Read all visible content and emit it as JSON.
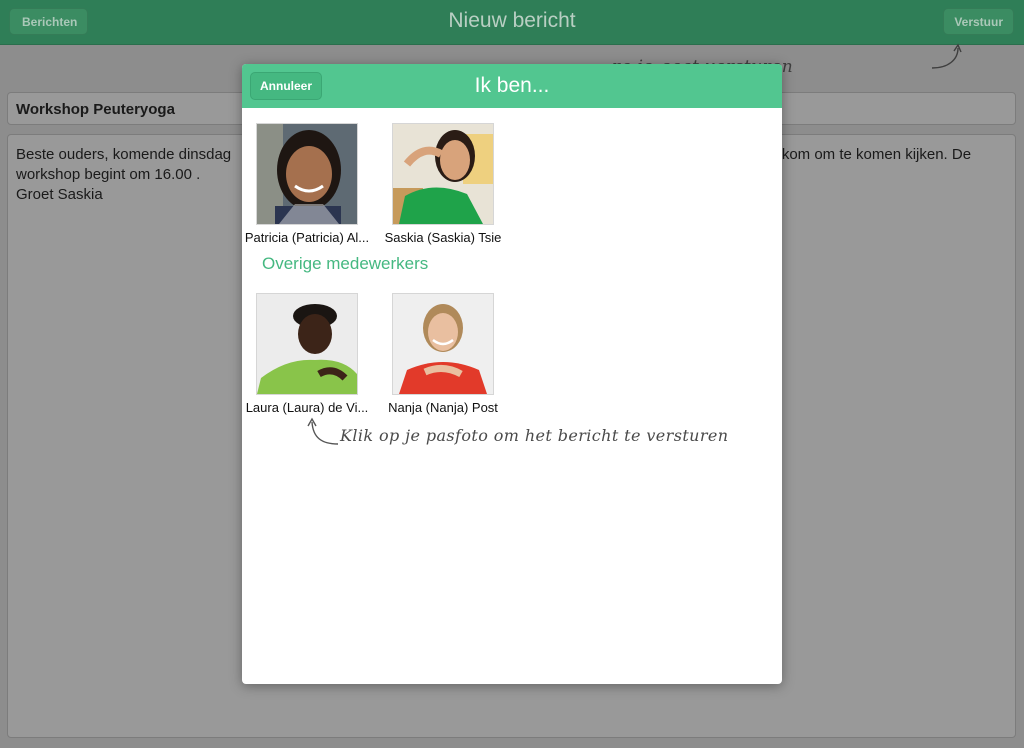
{
  "navbar": {
    "back_label": "Berichten",
    "title": "Nieuw bericht",
    "send_label": "Verstuur"
  },
  "message": {
    "subject": "Workshop Peuteryoga",
    "body_left": "Beste ouders, komende dinsdag",
    "body_right": "elkom om te komen kijken. De",
    "body_rest": "workshop begint om 16.00 .\nGroet Saskia"
  },
  "hint_top": "ra je gaat versturen",
  "modal": {
    "cancel_label": "Annuleer",
    "title": "Ik ben...",
    "people": [
      {
        "name": "Patricia (Patricia) Al..."
      },
      {
        "name": "Saskia (Saskia) Tsie"
      }
    ],
    "other_section_title": "Overige medewerkers",
    "other_people": [
      {
        "name": "Laura (Laura) de Vi..."
      },
      {
        "name": "Nanja (Nanja) Post"
      }
    ],
    "hint": "Klik op je pasfoto om het bericht te versturen"
  },
  "colors": {
    "accent": "#52c690",
    "accent_text": "#45b881",
    "dimmed_bar": "#2f7e57"
  }
}
